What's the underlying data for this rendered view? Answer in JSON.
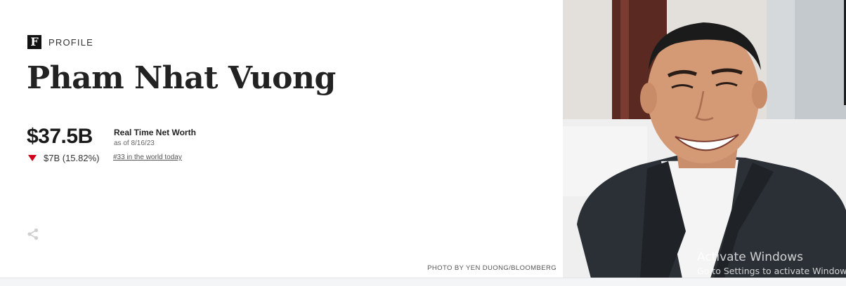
{
  "header": {
    "logo_letter": "F",
    "section_label": "PROFILE"
  },
  "profile": {
    "name": "Pham Nhat Vuong",
    "net_worth": "$37.5B",
    "change": "$7B (15.82%)",
    "change_direction": "down",
    "net_worth_title": "Real Time Net Worth",
    "as_of": "as of 8/16/23",
    "rank_link": "#33 in the world today"
  },
  "photo": {
    "credit": "PHOTO BY YEN DUONG/BLOOMBERG"
  },
  "os_overlay": {
    "title": "Activate Windows",
    "subtitle": "Go to Settings to activate Windows."
  },
  "colors": {
    "down": "#d0021b",
    "text": "#222222"
  },
  "icons": [
    "forbes-logo-icon",
    "down-triangle-icon",
    "share-icon"
  ]
}
